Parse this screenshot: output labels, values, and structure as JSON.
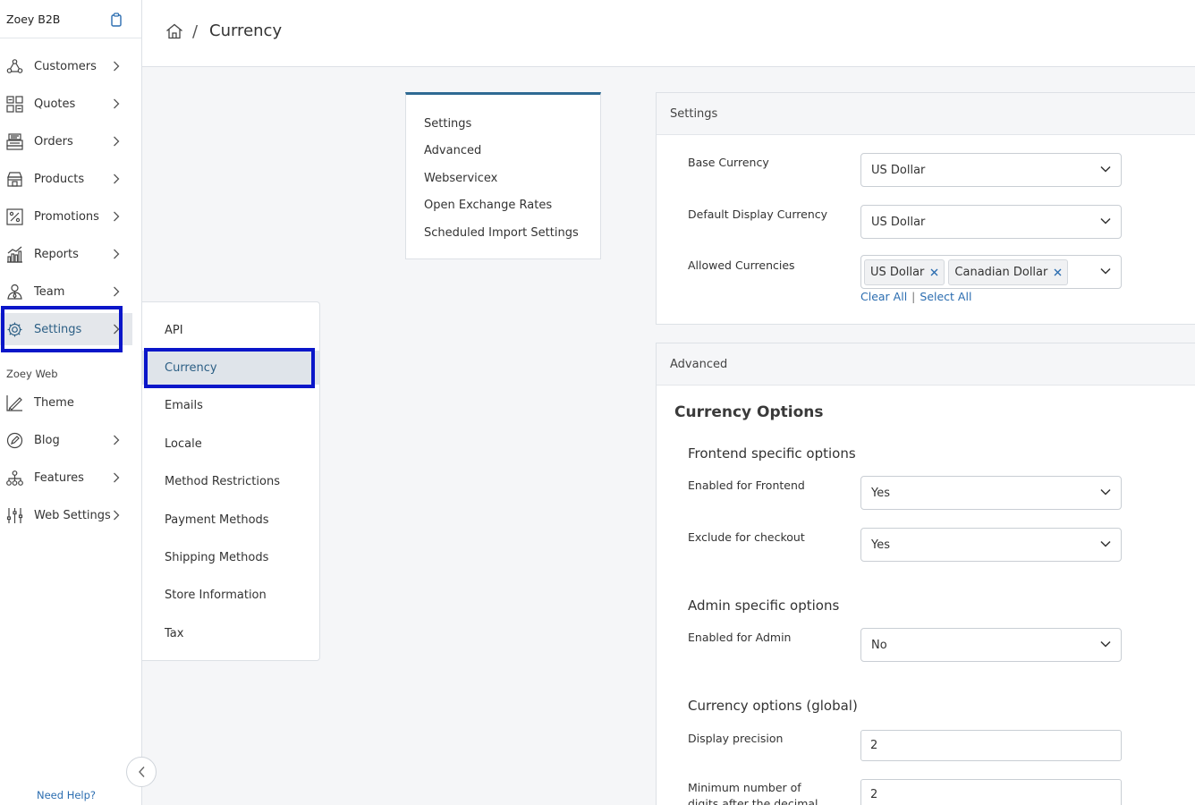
{
  "sidebar": {
    "brand": "Zoey B2B",
    "items": [
      {
        "label": "Customers",
        "icon": "customers-icon"
      },
      {
        "label": "Quotes",
        "icon": "quotes-icon"
      },
      {
        "label": "Orders",
        "icon": "orders-icon"
      },
      {
        "label": "Products",
        "icon": "products-icon"
      },
      {
        "label": "Promotions",
        "icon": "promotions-icon"
      },
      {
        "label": "Reports",
        "icon": "reports-icon"
      },
      {
        "label": "Team",
        "icon": "team-icon"
      },
      {
        "label": "Settings",
        "icon": "gear-icon",
        "active": true
      }
    ],
    "web_section_label": "Zoey Web",
    "web_items": [
      {
        "label": "Theme",
        "icon": "theme-icon"
      },
      {
        "label": "Blog",
        "icon": "blog-icon"
      },
      {
        "label": "Features",
        "icon": "features-icon"
      },
      {
        "label": "Web Settings",
        "icon": "sliders-icon"
      }
    ],
    "need_help": "Need Help?"
  },
  "header": {
    "separator": "/",
    "title": "Currency"
  },
  "submenu": {
    "items": [
      "API",
      "Currency",
      "Emails",
      "Locale",
      "Method Restrictions",
      "Payment Methods",
      "Shipping Methods",
      "Store Information",
      "Tax"
    ],
    "active": "Currency"
  },
  "page_tabs": [
    "Settings",
    "Advanced",
    "Webservicex",
    "Open Exchange Rates",
    "Scheduled Import Settings"
  ],
  "settings_panel": {
    "header": "Settings",
    "base_currency": {
      "label": "Base Currency",
      "value": "US Dollar"
    },
    "default_display_currency": {
      "label": "Default Display Currency",
      "value": "US Dollar"
    },
    "allowed_currencies": {
      "label": "Allowed Currencies",
      "tags": [
        "US Dollar",
        "Canadian Dollar"
      ],
      "clear_all": "Clear All",
      "link_separator": "|",
      "select_all": "Select All"
    }
  },
  "advanced_panel": {
    "header": "Advanced",
    "title": "Currency Options",
    "frontend_group": "Frontend specific options",
    "enabled_frontend": {
      "label": "Enabled for Frontend",
      "value": "Yes"
    },
    "exclude_checkout": {
      "label": "Exclude for checkout",
      "value": "Yes"
    },
    "admin_group": "Admin specific options",
    "enabled_admin": {
      "label": "Enabled for Admin",
      "value": "No"
    },
    "global_group": "Currency options (global)",
    "display_precision": {
      "label": "Display precision",
      "value": "2"
    },
    "min_digits": {
      "label": "Minimum number of digits after the decimal",
      "value": "2"
    }
  },
  "colors": {
    "accent": "#2f6a93",
    "highlight": "#0a16c9",
    "link": "#2b6db0"
  }
}
